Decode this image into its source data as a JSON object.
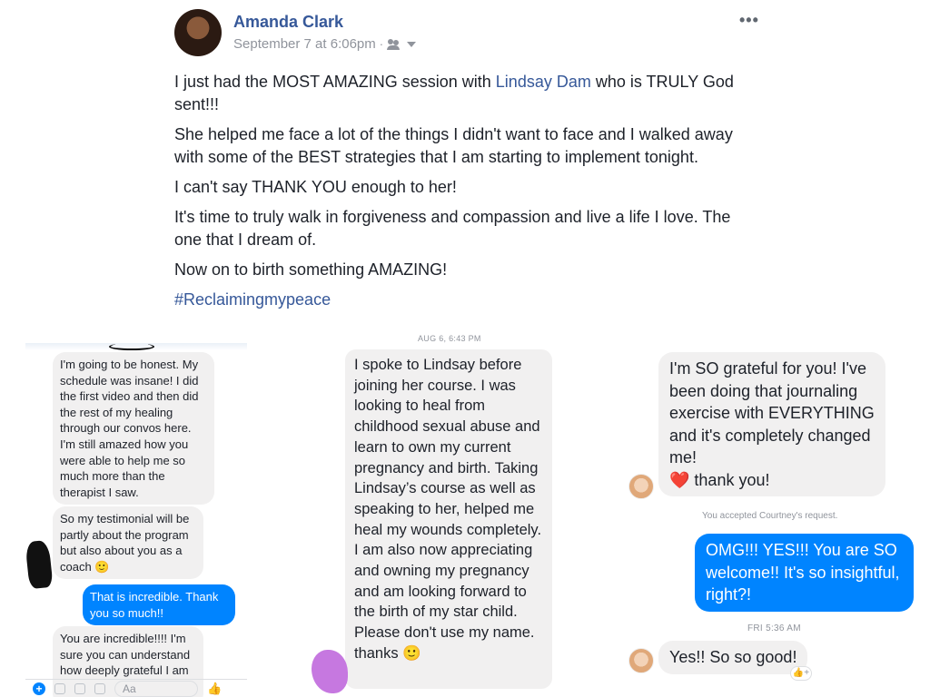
{
  "post": {
    "author": "Amanda Clark",
    "timestamp": "September 7 at 6:06pm",
    "separator": "·",
    "audience_icon": "friends-icon",
    "menu_icon": "more-horizontal-icon",
    "more_label": "•••",
    "paragraphs": {
      "p1_before": "I just had the MOST AMAZING session with ",
      "p1_mention": "Lindsay Dam",
      "p1_after": " who is TRULY God sent!!!",
      "p2": "She helped me face a lot of the things I didn't want to face and I walked away with some of the BEST strategies that I am starting to implement tonight.",
      "p3": "I can't say THANK YOU enough to her!",
      "p4": "It's time to truly walk in forgiveness and compassion and live a life I love. The one that I dream of.",
      "p5": "Now on to birth something AMAZING!"
    },
    "hashtag": "#Reclaimingmypeace"
  },
  "chat_left": {
    "messages": [
      {
        "text": "I'm going to be honest. My schedule was insane! I did the first video and then did the rest of my healing through our convos here. I'm still amazed how you were able to help me so much more than the therapist I saw."
      },
      {
        "text": "So my testimonial will be partly about the program but also about you as a coach 🙂"
      },
      {
        "text": "That is incredible.  Thank you so much!!"
      },
      {
        "text": "You are incredible!!!! I'm sure you can understand how deeply grateful I am"
      }
    ],
    "composer": {
      "placeholder": "Aa",
      "plus": "+",
      "like": "👍"
    }
  },
  "chat_middle": {
    "timestamp": "AUG 6, 6:43 PM",
    "message": "I spoke to Lindsay before joining her course. I was looking to heal from childhood sexual abuse and learn to own my current pregnancy and birth. Taking Lindsay’s course as well as speaking to her, helped me heal my wounds completely. I am also now appreciating and owning my pregnancy and am looking forward to the birth of my star child. Please don't use my name. thanks 🙂"
  },
  "chat_right": {
    "message_1_text": "I'm SO grateful for you! I've been doing that journaling exercise with EVERYTHING and it's completely changed me!",
    "message_1_heart": "❤️",
    "message_1_tail": " thank you!",
    "note": "You accepted Courtney's request.",
    "reply": "OMG!!! YES!!!  You are SO welcome!!  It's so insightful, right?!",
    "timestamp": "FRI 5:36 AM",
    "message_2": "Yes!! So so good!",
    "reaction_icon": "like-reaction-icon",
    "reaction_label": "👍+"
  },
  "colors": {
    "fb_link": "#365899",
    "messenger_blue": "#0084ff",
    "bubble_gray": "#f1f0f0",
    "meta_gray": "#90949c"
  }
}
